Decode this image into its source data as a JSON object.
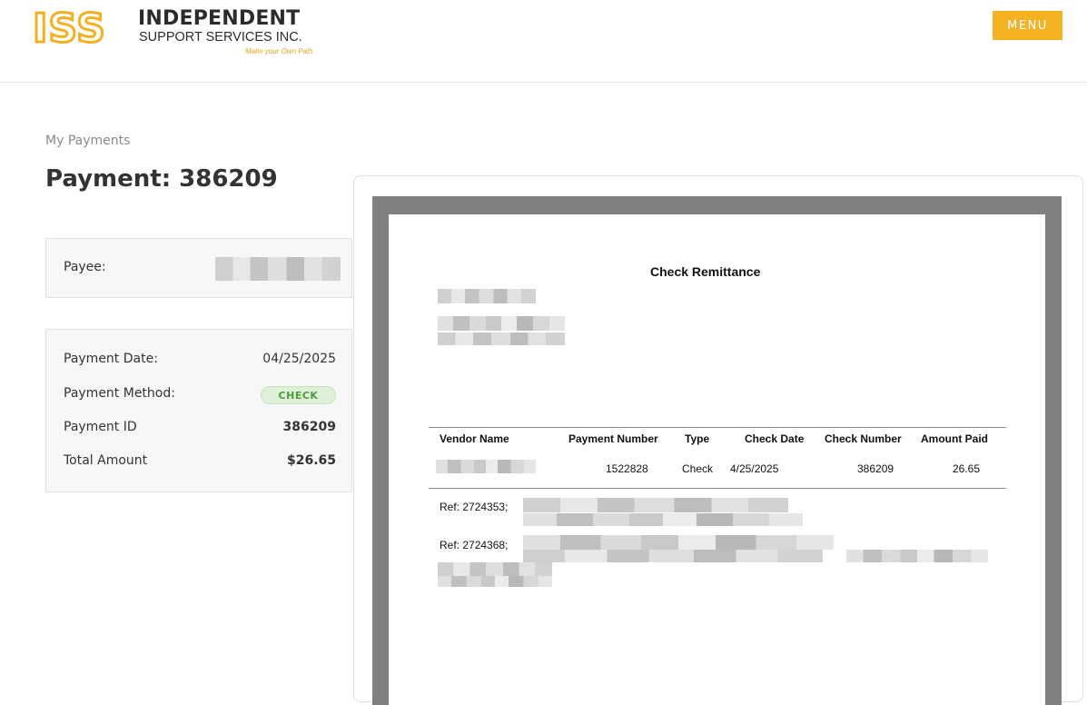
{
  "header": {
    "logo_mark": "ISS",
    "logo_title": "INDEPENDENT",
    "logo_subtitle": "SUPPORT SERVICES INC.",
    "logo_tagline": "Make your Own Path",
    "menu_label": "MENU",
    "accent_color": "#f4b223"
  },
  "page": {
    "breadcrumb": "My Payments",
    "title": "Payment: 386209"
  },
  "payee": {
    "label": "Payee:"
  },
  "details": {
    "payment_date_label": "Payment Date:",
    "payment_date_value": "04/25/2025",
    "payment_method_label": "Payment Method:",
    "payment_method_value": "CHECK",
    "payment_id_label": "Payment ID",
    "payment_id_value": "386209",
    "total_amount_label": "Total Amount",
    "total_amount_value": "$26.65"
  },
  "document": {
    "title": "Check Remittance",
    "columns": [
      "Vendor Name",
      "Payment Number",
      "Type",
      "Check Date",
      "Check Number",
      "Amount Paid"
    ],
    "row": {
      "payment_number": "1522828",
      "type": "Check",
      "check_date": "4/25/2025",
      "check_number": "386209",
      "amount_paid": "26.65"
    },
    "refs": [
      "Ref: 2724353;",
      "Ref: 2724368;"
    ]
  }
}
